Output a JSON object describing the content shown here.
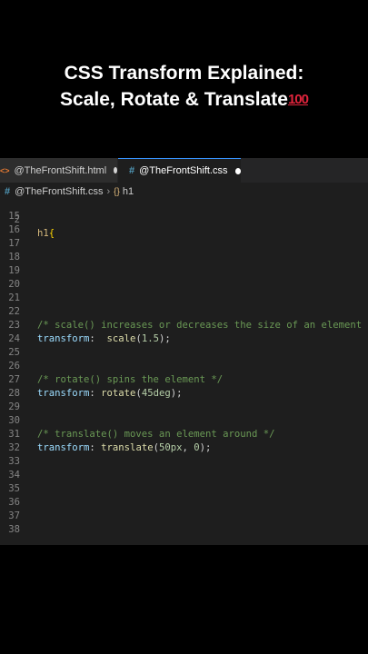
{
  "title": {
    "line1": "CSS Transform Explained:",
    "line2": "Scale, Rotate & Translate",
    "emoji": "100"
  },
  "tabs": [
    {
      "label": "@TheFrontShift.html"
    },
    {
      "label": "@TheFrontShift.css"
    }
  ],
  "breadcrumb": {
    "file": "@TheFrontShift.css",
    "symbol": "h1"
  },
  "code": {
    "sticky": {
      "num": "2",
      "selector": "h1",
      "brace": "{"
    },
    "line_numbers": [
      "15",
      "16",
      "17",
      "18",
      "19",
      "20",
      "21",
      "22",
      "23",
      "24",
      "25",
      "26",
      "27",
      "28",
      "29",
      "30",
      "31",
      "32",
      "33",
      "34",
      "35",
      "36",
      "37",
      "38"
    ],
    "scale_comment": "/* scale() increases or decreases the size of an element */",
    "scale_prop": "transform",
    "scale_fn": "scale",
    "scale_arg": "1.5",
    "rotate_comment": "/* rotate() spins the element */",
    "rotate_prop": "transform",
    "rotate_fn": "rotate",
    "rotate_arg": "45deg",
    "translate_comment": "/* translate() moves an element around */",
    "translate_prop": "transform",
    "translate_fn": "translate",
    "translate_arg1": "50px",
    "translate_arg2": "0"
  }
}
